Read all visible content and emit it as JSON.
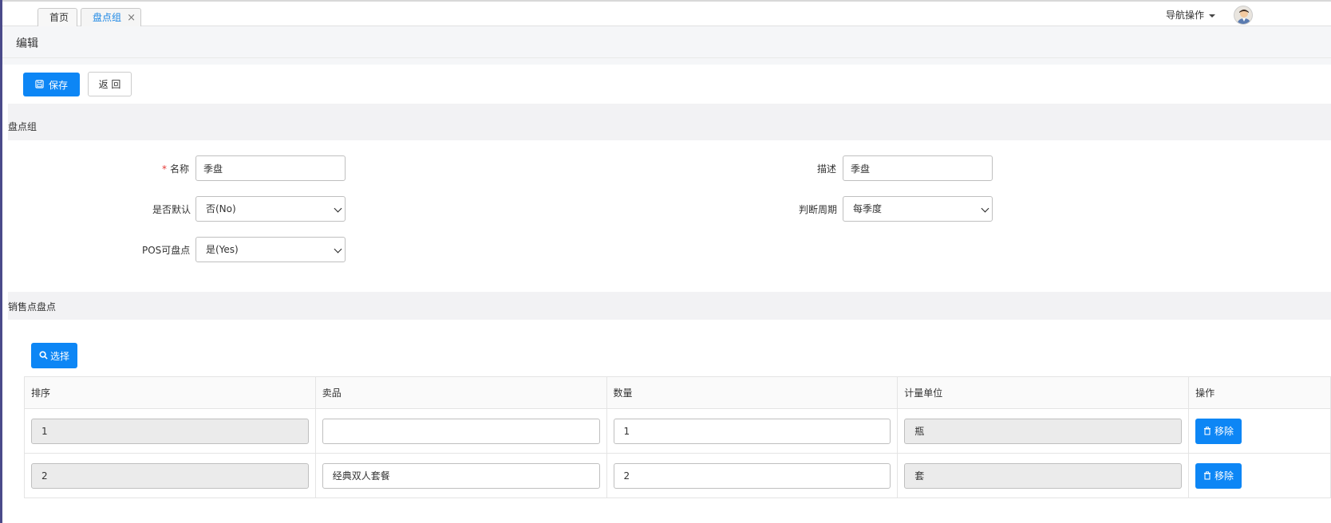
{
  "tabs": [
    {
      "label": "首页"
    },
    {
      "label": "盘点组",
      "close": "×"
    }
  ],
  "nav_ops": "导航操作",
  "page_title": "编辑",
  "toolbar": {
    "save_label": "保存",
    "back_label": "返 回"
  },
  "section_group": {
    "title": "盘点组"
  },
  "form": {
    "name": {
      "label": "名称",
      "required_mark": "*",
      "value": "季盘"
    },
    "description": {
      "label": "描述",
      "value": "季盘"
    },
    "is_default": {
      "label": "是否默认",
      "value": "否(No)"
    },
    "cycle": {
      "label": "判断周期",
      "value": "每季度"
    },
    "pos_countable": {
      "label": "POS可盘点",
      "value": "是(Yes)"
    }
  },
  "section_pos": {
    "title": "销售点盘点",
    "select_label": "选择"
  },
  "table": {
    "headers": [
      "排序",
      "卖品",
      "数量",
      "计量单位",
      "操作"
    ],
    "rows": [
      {
        "order": "1",
        "item": "",
        "qty": "1",
        "unit": "瓶",
        "action": "移除"
      },
      {
        "order": "2",
        "item": "经典双人套餐",
        "qty": "2",
        "unit": "套",
        "action": "移除"
      }
    ]
  },
  "colors": {
    "primary": "#0d86f5",
    "tab_active": "#1e88e5",
    "required": "#e53935"
  },
  "icons": {
    "save": "save-icon",
    "search": "search-icon",
    "trash": "trash-icon",
    "avatar": "user-avatar"
  }
}
